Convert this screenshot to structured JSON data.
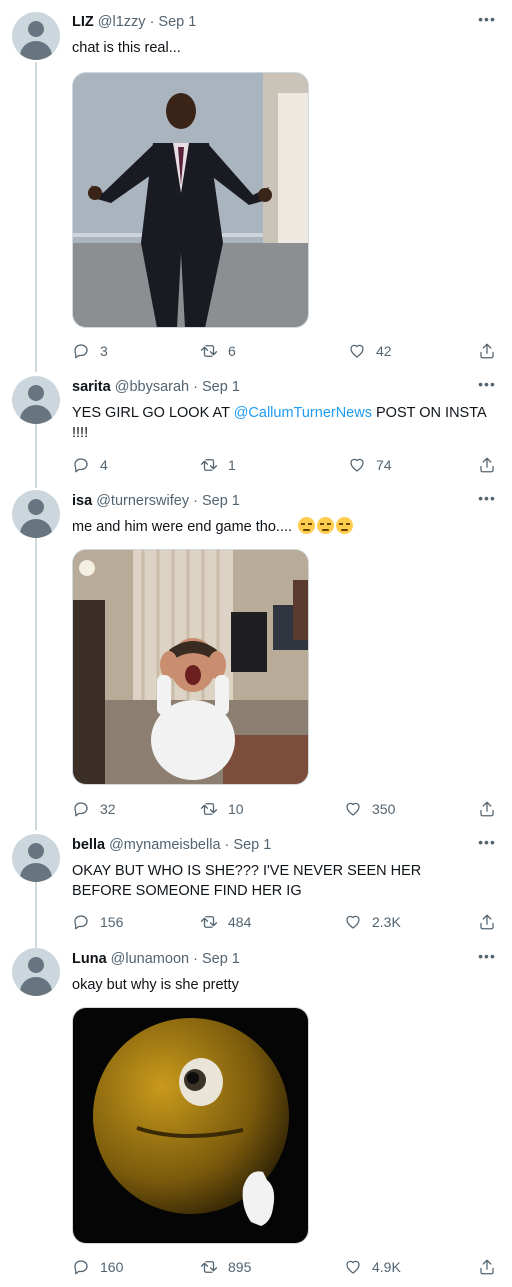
{
  "tweets": [
    {
      "name": "LIZ",
      "handle": "@l1zzy",
      "date": "· Sep 1",
      "text": "chat is this real...",
      "replies": "3",
      "retweets": "6",
      "likes": "42",
      "media_alt": "man in suit with arms out"
    },
    {
      "name": "sarita",
      "handle": "@bbysarah",
      "date": "· Sep 1",
      "text_before": "YES GIRL GO LOOK AT ",
      "mention": "@CallumTurnerNews",
      "text_after": " POST ON INSTA !!!!",
      "replies": "4",
      "retweets": "1",
      "likes": "74"
    },
    {
      "name": "isa",
      "handle": "@turnerswifey",
      "date": "· Sep 1",
      "text": "me and him were end game tho....",
      "emojis": [
        "pensive-face",
        "pensive-face",
        "pensive-face"
      ],
      "replies": "32",
      "retweets": "10",
      "likes": "350",
      "media_alt": "kid screaming holding head"
    },
    {
      "name": "bella",
      "handle": "@mynameisbella",
      "date": "· Sep 1",
      "text": "OKAY BUT WHO IS SHE??? I'VE NEVER SEEN HER BEFORE SOMEONE FIND HER IG",
      "replies": "156",
      "retweets": "484",
      "likes": "2.3K"
    },
    {
      "name": "Luna",
      "handle": "@lunamoon",
      "date": "· Sep 1",
      "text": "okay but why is she pretty",
      "replies": "160",
      "retweets": "895",
      "likes": "4.9K",
      "media_alt": "3d yellow emoji face in dark"
    }
  ],
  "icons": {
    "reply": "reply-icon",
    "retweet": "retweet-icon",
    "like": "heart-icon",
    "share": "share-icon",
    "more": "more-icon"
  },
  "colors": {
    "text": "#0f1419",
    "secondary": "#536471",
    "mention": "#1d9bf0",
    "thread_line": "#cfd9de"
  }
}
